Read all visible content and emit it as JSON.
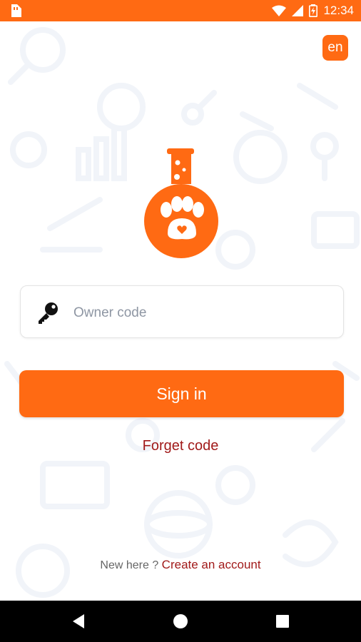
{
  "status_bar": {
    "time": "12:34"
  },
  "language": {
    "label": "en"
  },
  "login": {
    "owner_code_placeholder": "Owner code",
    "sign_in_label": "Sign in",
    "forget_code_label": "Forget code"
  },
  "footer": {
    "new_here_text": "New here ?",
    "create_account_label": "Create an account"
  },
  "navigation": {
    "back": "back-icon",
    "home": "home-icon",
    "recents": "recents-icon"
  },
  "colors": {
    "accent": "#ff6a13",
    "link": "#a11a1a"
  }
}
